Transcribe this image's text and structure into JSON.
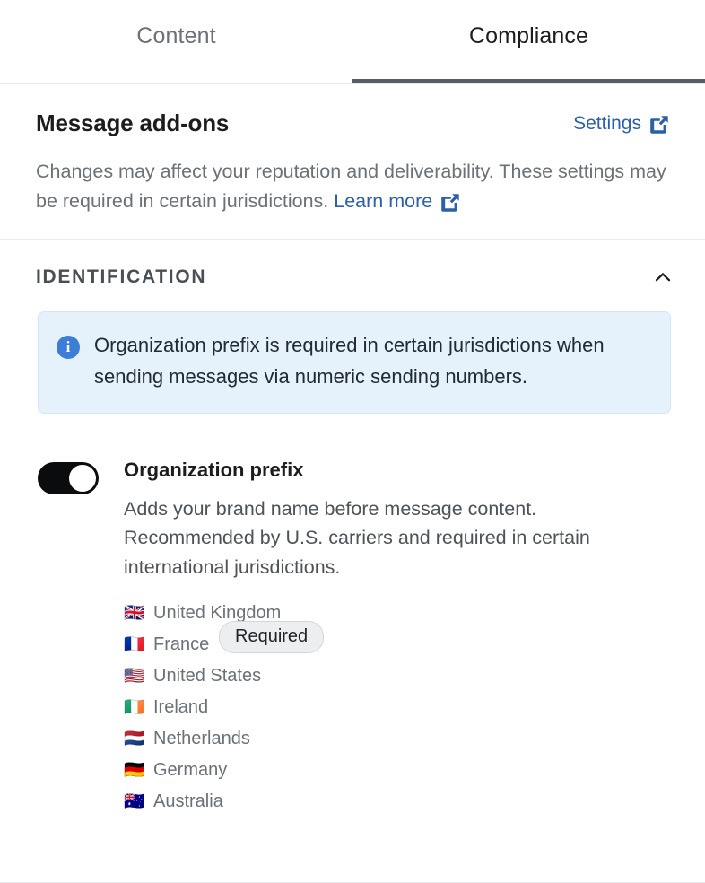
{
  "tabs": [
    {
      "label": "Content",
      "active": false
    },
    {
      "label": "Compliance",
      "active": true
    }
  ],
  "addons": {
    "title": "Message add-ons",
    "settings_label": "Settings",
    "description_before": "Changes may affect your reputation and deliverability. These settings may be required in certain jurisdictions.",
    "learn_more_label": "Learn more"
  },
  "identification": {
    "title": "IDENTIFICATION",
    "collapse_icon": "chevron-up-icon",
    "banner": {
      "icon": "info-icon",
      "text": "Organization prefix is required in certain jurisdictions when sending messages via numeric sending numbers."
    },
    "setting": {
      "toggle_state": "on",
      "title": "Organization prefix",
      "description": "Adds your brand name before message content. Recommended by U.S. carriers and required in certain international jurisdictions.",
      "badge": "Required",
      "countries": [
        {
          "flag": "🇬🇧",
          "name": "United Kingdom"
        },
        {
          "flag": "🇫🇷",
          "name": "France"
        },
        {
          "flag": "🇺🇸",
          "name": "United States"
        },
        {
          "flag": "🇮🇪",
          "name": "Ireland"
        },
        {
          "flag": "🇳🇱",
          "name": "Netherlands"
        },
        {
          "flag": "🇩🇪",
          "name": "Germany"
        },
        {
          "flag": "🇦🇺",
          "name": "Australia"
        }
      ]
    }
  },
  "colors": {
    "link": "#2b5fa8",
    "active_tab_underline": "#585d63",
    "banner_bg": "#e5f1fb",
    "toggle_on": "#0b0c0d"
  }
}
